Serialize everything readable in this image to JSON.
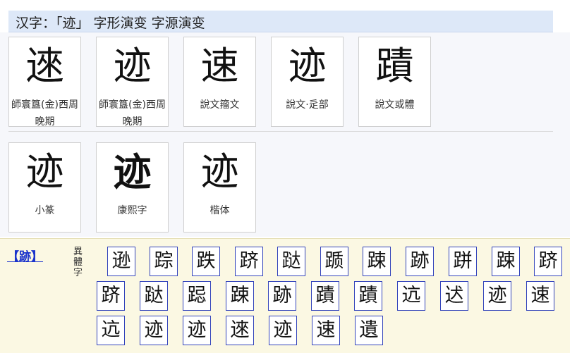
{
  "header": {
    "title": "汉字：「迹」 字形演变 字源演变"
  },
  "evolution": [
    {
      "glyph": "逨",
      "caption": "師寰簋(金)西周晚期"
    },
    {
      "glyph": "迹",
      "caption": "師寰簋(金)西周晚期"
    },
    {
      "glyph": "速",
      "caption": "說文籀文"
    },
    {
      "glyph": "迹",
      "caption": "說文·辵部"
    },
    {
      "glyph": "蹟",
      "caption": "說文或體"
    },
    {
      "glyph": "迹",
      "caption": "小篆"
    },
    {
      "glyph": "迹",
      "caption": "康熙字"
    },
    {
      "glyph": "迹",
      "caption": "楷体"
    }
  ],
  "variants": {
    "head": "【跡】",
    "label": "異體字",
    "chars": [
      "逊",
      "踪",
      "跌",
      "跻",
      "跶",
      "踬",
      "踈",
      "跡",
      "跰",
      "踈",
      "跻",
      "跻",
      "跶",
      "跽",
      "踈",
      "跡",
      "蹟",
      "蹟",
      "迒",
      "迖",
      "迹",
      "速",
      "迒",
      "迹",
      "迹",
      "逨",
      "迹",
      "速",
      "遺"
    ]
  }
}
